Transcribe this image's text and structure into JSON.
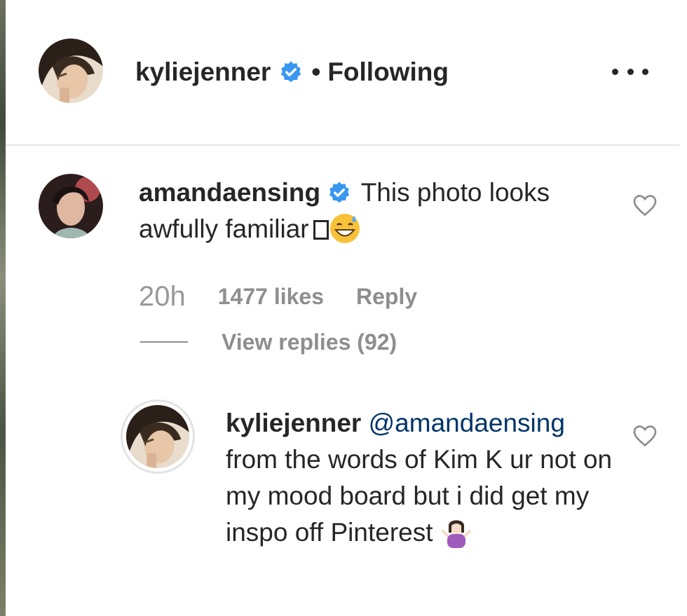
{
  "header": {
    "username": "kyliejenner",
    "separator": "•",
    "follow_status": "Following",
    "more_icon": "more-horizontal-icon"
  },
  "comments": [
    {
      "username": "amandaensing",
      "verified": true,
      "text": "This photo looks awfully familiar",
      "trailing_glyphs": [
        "box-glyph",
        "grinning-sweat-emoji"
      ],
      "time": "20h",
      "likes": "1477 likes",
      "reply_label": "Reply",
      "view_replies": "View replies (92)"
    }
  ],
  "reply": {
    "username": "kyliejenner",
    "mention": "@amandaensing",
    "text": "from the words of Kim K ur not on my mood board but i did get my inspo off Pinterest",
    "trailing_emoji": "shrugging-woman-emoji"
  },
  "colors": {
    "text": "#262626",
    "secondary": "#8e8e8e",
    "verified_blue": "#3897f0",
    "mention": "#003569",
    "divider": "#e6e6e6"
  }
}
